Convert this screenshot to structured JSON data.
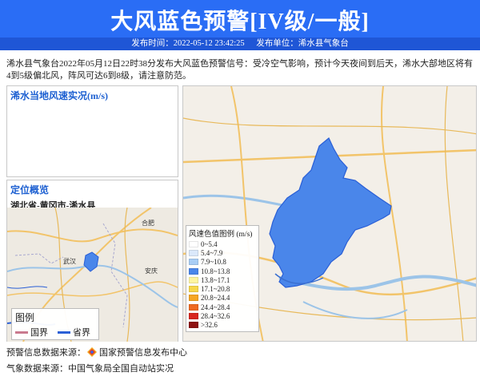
{
  "header": {
    "title": "大风蓝色预警[IV级/一般]",
    "publish_time_label": "发布时间：2022-05-12 23:42:25",
    "publisher_label": "发布单位：浠水县气象台",
    "brand_color": "#2a6df5"
  },
  "description": "浠水县气象台2022年05月12日22时38分发布大风蓝色预警信号：受冷空气影响，预计今天夜间到后天，浠水大部地区将有4到5级偏北风，阵风可达6到8级，请注意防范。",
  "wind_panel": {
    "title": "浠水当地风速实况(m/s)"
  },
  "location_panel": {
    "title": "定位概览",
    "location": "湖北省-黄冈市-浠水县",
    "map_labels": [
      "合肥",
      "安庆",
      "武汉"
    ]
  },
  "boundary_legend": {
    "title": "图例",
    "items": [
      {
        "label": "国界",
        "color": "#c97a8e"
      },
      {
        "label": "省界",
        "color": "#2a5fd6"
      }
    ]
  },
  "wind_legend": {
    "title": "风速色值图例 (m/s)",
    "items": [
      {
        "label": "0~5.4",
        "color": "#ffffff"
      },
      {
        "label": "5.4~7.9",
        "color": "#dbe9fb"
      },
      {
        "label": "7.9~10.8",
        "color": "#a8cdf5"
      },
      {
        "label": "10.8~13.8",
        "color": "#4a86ea"
      },
      {
        "label": "13.8~17.1",
        "color": "#fff5a0"
      },
      {
        "label": "17.1~20.8",
        "color": "#f7d84a"
      },
      {
        "label": "20.8~24.4",
        "color": "#f5a623"
      },
      {
        "label": "24.4~28.4",
        "color": "#ef6a22"
      },
      {
        "label": "28.4~32.6",
        "color": "#d8261e"
      },
      {
        "label": ">32.6",
        "color": "#8e1212"
      }
    ]
  },
  "footer": {
    "source_prefix": "预警信息数据来源：",
    "source_name": "国家预警信息发布中心",
    "weather_source": "气象数据来源：中国气象局全国自动站实况"
  },
  "warning_area_color": "#4a86ea"
}
